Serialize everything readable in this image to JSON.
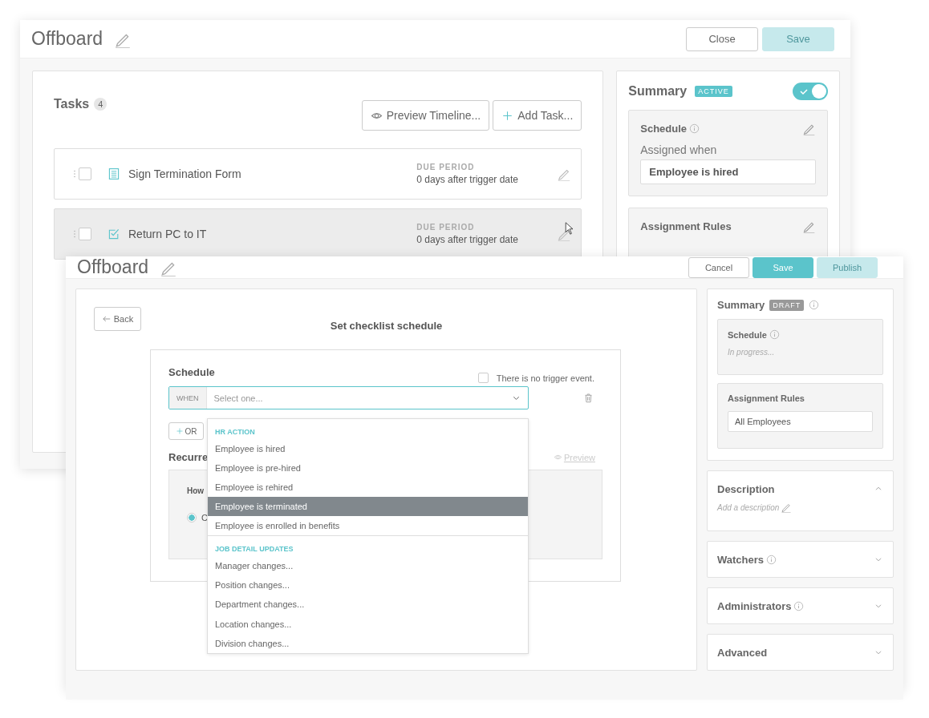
{
  "back_window": {
    "title": "Offboard",
    "buttons": [
      {
        "label": "Close",
        "kind": "secondary",
        "disabled": false
      },
      {
        "label": "Save",
        "kind": "primary",
        "disabled": true
      }
    ],
    "tasks": {
      "title": "Tasks",
      "count": "4",
      "actions": [
        {
          "label": "Preview Timeline...",
          "kind": "preview"
        },
        {
          "label": "Add Task...",
          "kind": "add"
        }
      ],
      "rows": [
        {
          "name": "Sign Termination Form",
          "kind": "form",
          "checked": false,
          "hovered": false,
          "due_label": "DUE PERIOD",
          "due": "0 days after trigger date"
        },
        {
          "name": "Return PC to IT",
          "kind": "todo",
          "checked": false,
          "hovered": true,
          "due_label": "DUE PERIOD",
          "due": "0 days after trigger date"
        }
      ]
    },
    "summary": {
      "title": "Summary",
      "status": {
        "label": "ACTIVE",
        "kind": "active"
      },
      "on": true,
      "schedule": {
        "title": "Schedule",
        "label": "Assigned when",
        "value": "Employee is hired"
      },
      "assignment_rules": {
        "title": "Assignment Rules"
      }
    }
  },
  "front_window": {
    "title": "Offboard",
    "buttons": [
      {
        "label": "Cancel",
        "kind": "secondary",
        "disabled": false
      },
      {
        "label": "Save",
        "kind": "primary",
        "disabled": false
      },
      {
        "label": "Publish",
        "kind": "primary",
        "disabled": true
      }
    ],
    "back_button": "Back",
    "page_title": "Set checklist schedule",
    "schedule": {
      "title": "Schedule",
      "no_trigger": {
        "label": "There is no trigger event.",
        "checked": false
      },
      "when_label": "WHEN",
      "select_placeholder": "Select one...",
      "or_button": "OR",
      "recurrence_title": "Recurre",
      "preview_link": "Preview",
      "question": "How",
      "option": {
        "label": "C",
        "selected": true
      }
    },
    "dropdown": {
      "groups": [
        {
          "title": "HR ACTION",
          "options": [
            {
              "label": "Employee is hired",
              "selected": false
            },
            {
              "label": "Employee is pre-hired",
              "selected": false
            },
            {
              "label": "Employee is rehired",
              "selected": false
            },
            {
              "label": "Employee is terminated",
              "selected": true
            },
            {
              "label": "Employee is enrolled in benefits",
              "selected": false
            }
          ]
        },
        {
          "title": "JOB DETAIL UPDATES",
          "options": [
            {
              "label": "Manager changes...",
              "selected": false
            },
            {
              "label": "Position changes...",
              "selected": false
            },
            {
              "label": "Department changes...",
              "selected": false
            },
            {
              "label": "Location changes...",
              "selected": false
            },
            {
              "label": "Division changes...",
              "selected": false
            }
          ]
        }
      ]
    },
    "summary": {
      "title": "Summary",
      "status": {
        "label": "DRAFT",
        "kind": "draft"
      },
      "schedule": {
        "title": "Schedule",
        "value": "In progress..."
      },
      "assignment_rules": {
        "title": "Assignment Rules",
        "value": "All Employees"
      }
    },
    "sections": [
      {
        "title": "Description",
        "expanded": true,
        "info": false,
        "placeholder": "Add a description"
      },
      {
        "title": "Watchers",
        "expanded": false,
        "info": true
      },
      {
        "title": "Administrators",
        "expanded": false,
        "info": true
      },
      {
        "title": "Advanced",
        "expanded": false,
        "info": false
      }
    ]
  }
}
